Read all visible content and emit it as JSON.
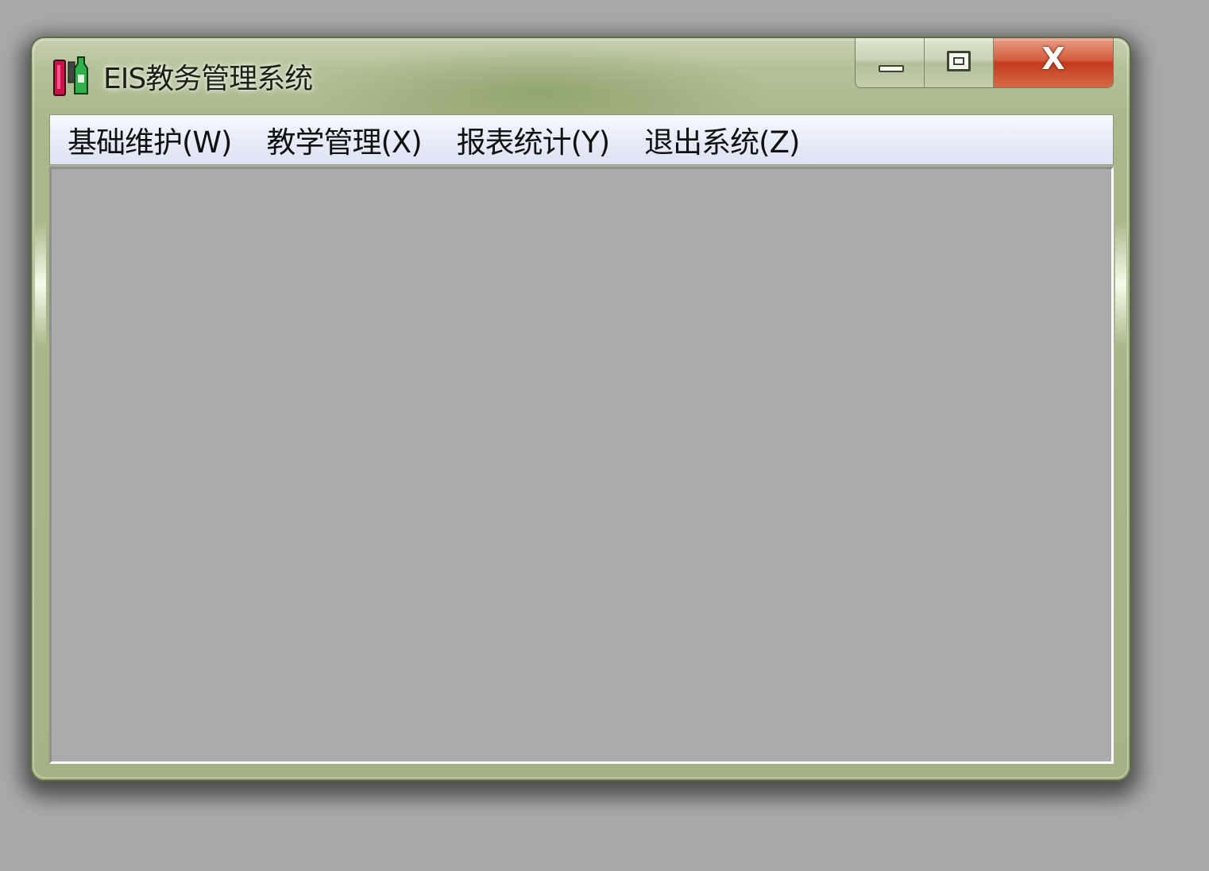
{
  "window": {
    "title": "EIS教务管理系统"
  },
  "caption_buttons": {
    "minimize_icon": "minimize-icon",
    "maximize_icon": "maximize-icon",
    "close_label": "X"
  },
  "menu": {
    "items": [
      {
        "label": "基础维护(W)"
      },
      {
        "label": "教学管理(X)"
      },
      {
        "label": "报表统计(Y)"
      },
      {
        "label": "退出系统(Z)"
      }
    ]
  },
  "colors": {
    "frame": "#a9b98b",
    "close_button": "#c33b1a",
    "menubar": "#e8eef8",
    "client_area": "#ababab",
    "desktop": "#a9a9a9"
  }
}
